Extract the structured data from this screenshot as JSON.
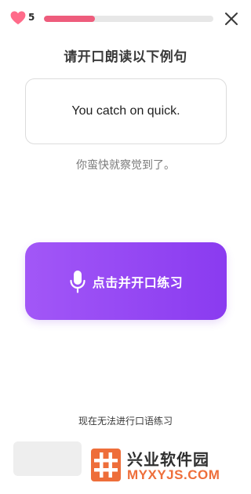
{
  "header": {
    "lives": "5",
    "progress": 0.3
  },
  "prompt": {
    "title": "请开口朗读以下例句",
    "sentence": "You catch on quick.",
    "translation": "你蛮快就察觉到了。"
  },
  "actions": {
    "speak_label": "点击并开口练习",
    "skip_label": "现在无法进行口语练习"
  },
  "watermark": {
    "title": "兴业软件园",
    "url": "MYXYJS.COM"
  },
  "colors": {
    "accent_gradient_start": "#a257f7",
    "accent_gradient_end": "#8a3bf0",
    "progress_fill": "#ee5c7c",
    "heart": "#ff6b8a",
    "watermark_orange": "#ee6e3a"
  },
  "icons": {
    "lives": "heart-icon",
    "close": "close-icon",
    "speak": "microphone-icon"
  }
}
